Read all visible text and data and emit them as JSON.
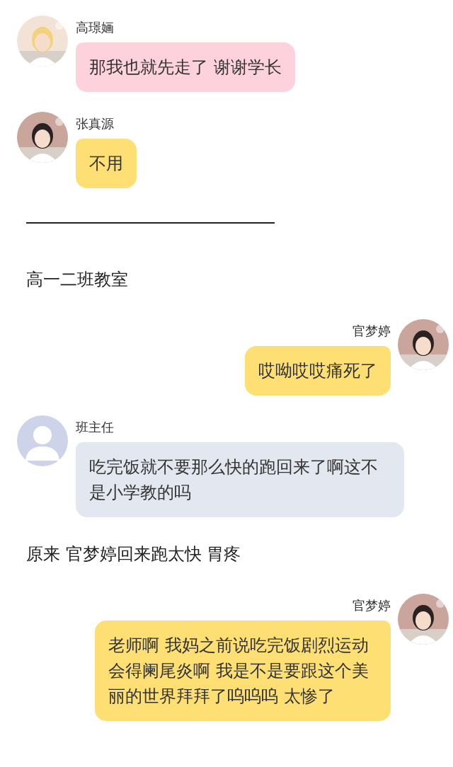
{
  "items": [
    {
      "kind": "message",
      "outgoing": false,
      "name": "高璟婳",
      "text": "那我也就先走了 谢谢学长",
      "color": "#fdd2dd"
    },
    {
      "kind": "message",
      "outgoing": false,
      "name": "张真源",
      "text": "不用",
      "color": "#fedf74"
    },
    {
      "kind": "divider"
    },
    {
      "kind": "narration",
      "text": "高一二班教室"
    },
    {
      "kind": "message",
      "outgoing": true,
      "name": "官梦婷",
      "text": "哎呦哎哎痛死了",
      "color": "#fedf74"
    },
    {
      "kind": "message",
      "outgoing": false,
      "name": "班主任",
      "text": "吃完饭就不要那么快的跑回来了啊这不是小学教的吗",
      "color": "#e2e7f0",
      "avatar": {
        "kind": "default"
      }
    },
    {
      "kind": "narration",
      "text": "原来 官梦婷回来跑太快 胃疼"
    },
    {
      "kind": "message",
      "outgoing": true,
      "name": "官梦婷",
      "text": "老师啊 我妈之前说吃完饭剧烈运动会得阑尾炎啊 我是不是要跟这个美丽的世界拜拜了呜呜呜 太惨了",
      "color": "#fedf74"
    }
  ]
}
